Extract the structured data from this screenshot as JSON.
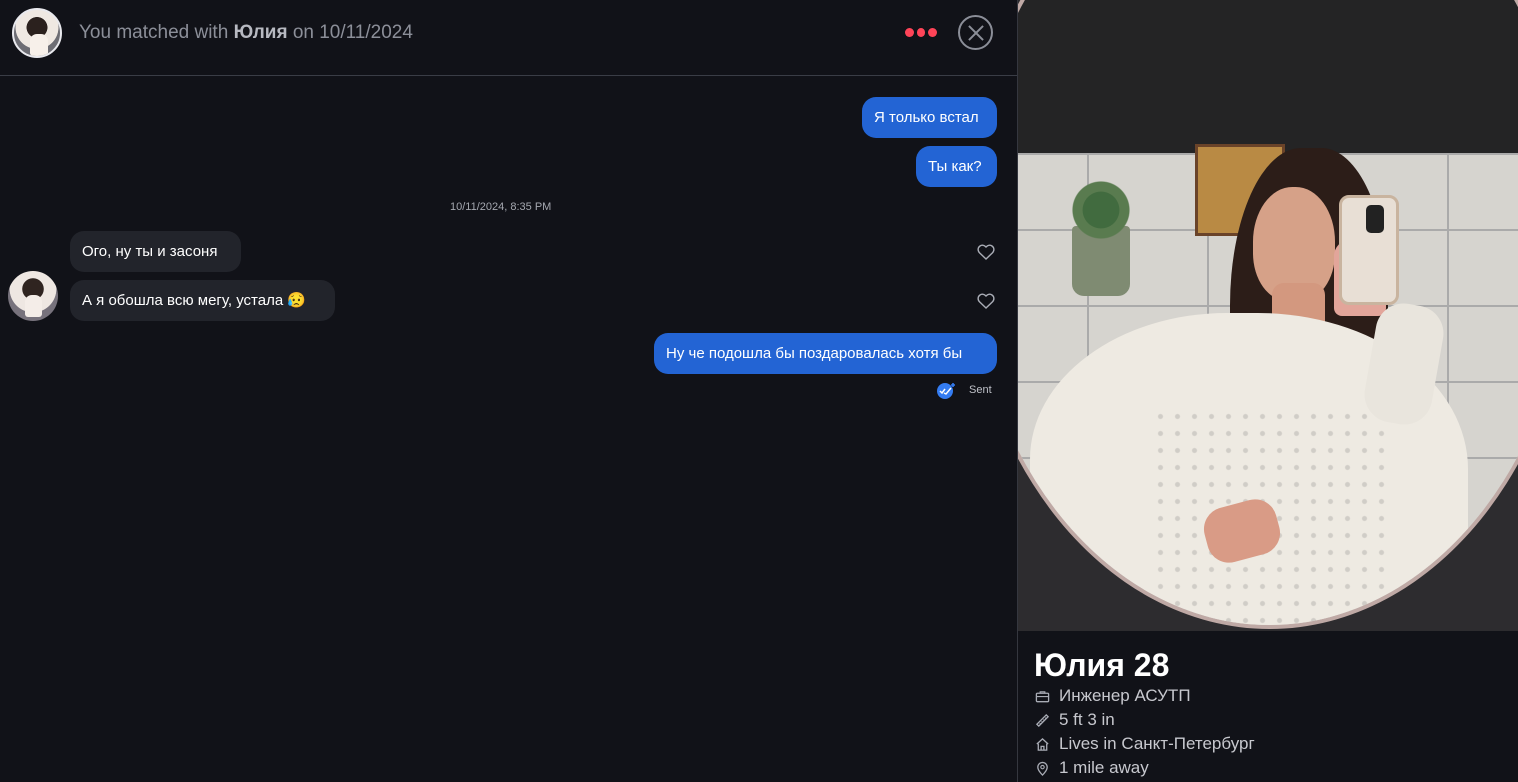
{
  "chat": {
    "match_prefix": "You matched with",
    "match_name": "Юлия",
    "match_suffix": "on 10/11/2024",
    "timestamp": "10/11/2024, 8:35 PM",
    "messages": [
      {
        "direction": "outgoing",
        "text": "Я только встал"
      },
      {
        "direction": "outgoing",
        "text": "Ты как?"
      },
      {
        "direction": "incoming",
        "text": "Ого, ну ты и засоня"
      },
      {
        "direction": "incoming",
        "text": "А я обошла всю мегу, устала 😥"
      },
      {
        "direction": "outgoing",
        "text": "Ну че подошла бы поздаровалась хотя бы"
      }
    ],
    "status": "Sent"
  },
  "profile": {
    "name": "Юлия",
    "age": "28",
    "details": [
      {
        "icon": "briefcase-icon",
        "text": "Инженер АСУТП"
      },
      {
        "icon": "ruler-icon",
        "text": "5 ft 3 in"
      },
      {
        "icon": "home-icon",
        "text": "Lives in Санкт-Петербург"
      },
      {
        "icon": "location-pin-icon",
        "text": "1 mile away"
      }
    ]
  },
  "colors": {
    "background": "#111218",
    "outgoing": "#2364d4",
    "incoming": "#22242b",
    "accent": "#ff4458"
  }
}
